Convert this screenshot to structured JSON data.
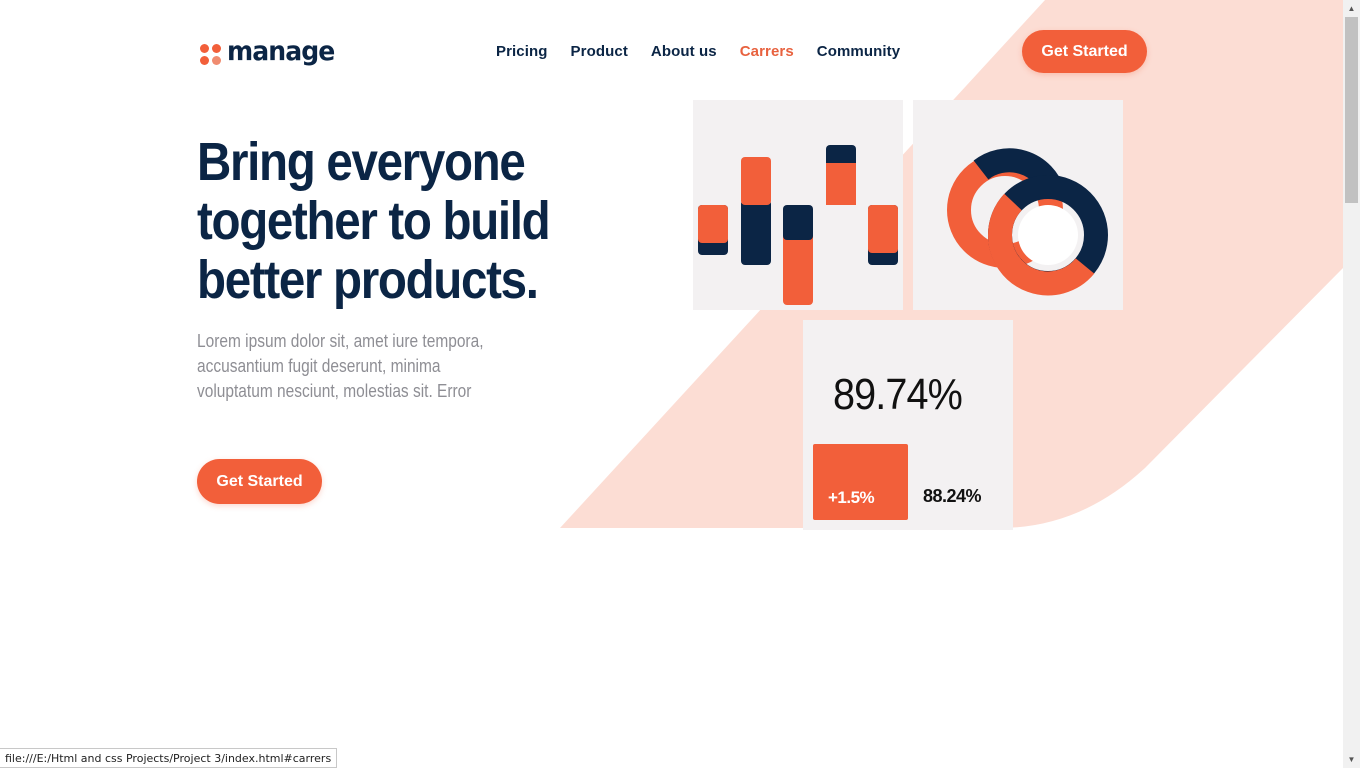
{
  "brand": {
    "name": "manage",
    "color": "#f25f3a",
    "dark": "#0b2545",
    "accent_light": "#fcddd4"
  },
  "nav": {
    "items": [
      {
        "label": "Pricing",
        "active": false
      },
      {
        "label": "Product",
        "active": false
      },
      {
        "label": "About us",
        "active": false
      },
      {
        "label": "Carrers",
        "active": true
      },
      {
        "label": "Community",
        "active": false
      }
    ],
    "cta_label": "Get Started"
  },
  "hero": {
    "title": "Bring everyone together to build better products.",
    "description": "Lorem ipsum dolor sit, amet iure tempora, accusantium fugit deserunt, minima voluptatum nesciunt, molestias sit. Error",
    "cta_label": "Get Started"
  },
  "stats": {
    "main_value": "89.74%",
    "change": "+1.5%",
    "secondary_value": "88.24%"
  },
  "status_bar": {
    "url": "file:///E:/Html and css Projects/Project 3/index.html#carrers"
  },
  "icons": {
    "logo": "four-dots-icon",
    "scroll_up": "arrow-up-icon",
    "scroll_down": "arrow-down-icon"
  }
}
